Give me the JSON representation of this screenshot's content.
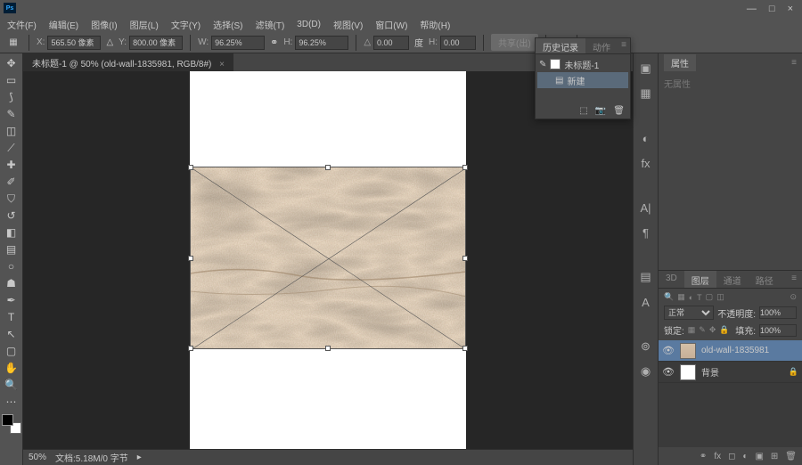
{
  "menu": {
    "file": "文件(F)",
    "edit": "编辑(E)",
    "image": "图像(I)",
    "layer": "图层(L)",
    "type": "文字(Y)",
    "select": "选择(S)",
    "filter": "滤镜(T)",
    "threeD": "3D(D)",
    "view": "视图(V)",
    "window": "窗口(W)",
    "help": "帮助(H)"
  },
  "options": {
    "x_label": "X:",
    "x_value": "565.50 像素",
    "y_label": "Y:",
    "y_value": "800.00 像素",
    "w_label": "W:",
    "w_value": "96.25%",
    "h_label": "H:",
    "h_value": "96.25%",
    "angle_label": "△",
    "angle_value": "0.00",
    "degree": "度",
    "skew_label": "H:",
    "skew_value": "0.00",
    "share": "共享(出)"
  },
  "doc_tab": {
    "title": "未标题-1 @ 50% (old-wall-1835981, RGB/8#)",
    "close": "×"
  },
  "statusbar": {
    "zoom": "50%",
    "info": "文档:5.18M/0 字节"
  },
  "history": {
    "tab1": "历史记录",
    "tab2": "动作",
    "doc_name": "未标题-1",
    "step1": "新建"
  },
  "properties": {
    "tab": "属性",
    "no_props": "无属性"
  },
  "layers": {
    "tabs": {
      "threeD": "3D",
      "layers": "图层",
      "channels": "通道",
      "paths": "路径"
    },
    "blend": "正常",
    "opacity_label": "不透明度:",
    "opacity": "100%",
    "lock_label": "锁定:",
    "fill_label": "填充:",
    "fill": "100%",
    "layer1": "old-wall-1835981",
    "layer2": "背景"
  }
}
